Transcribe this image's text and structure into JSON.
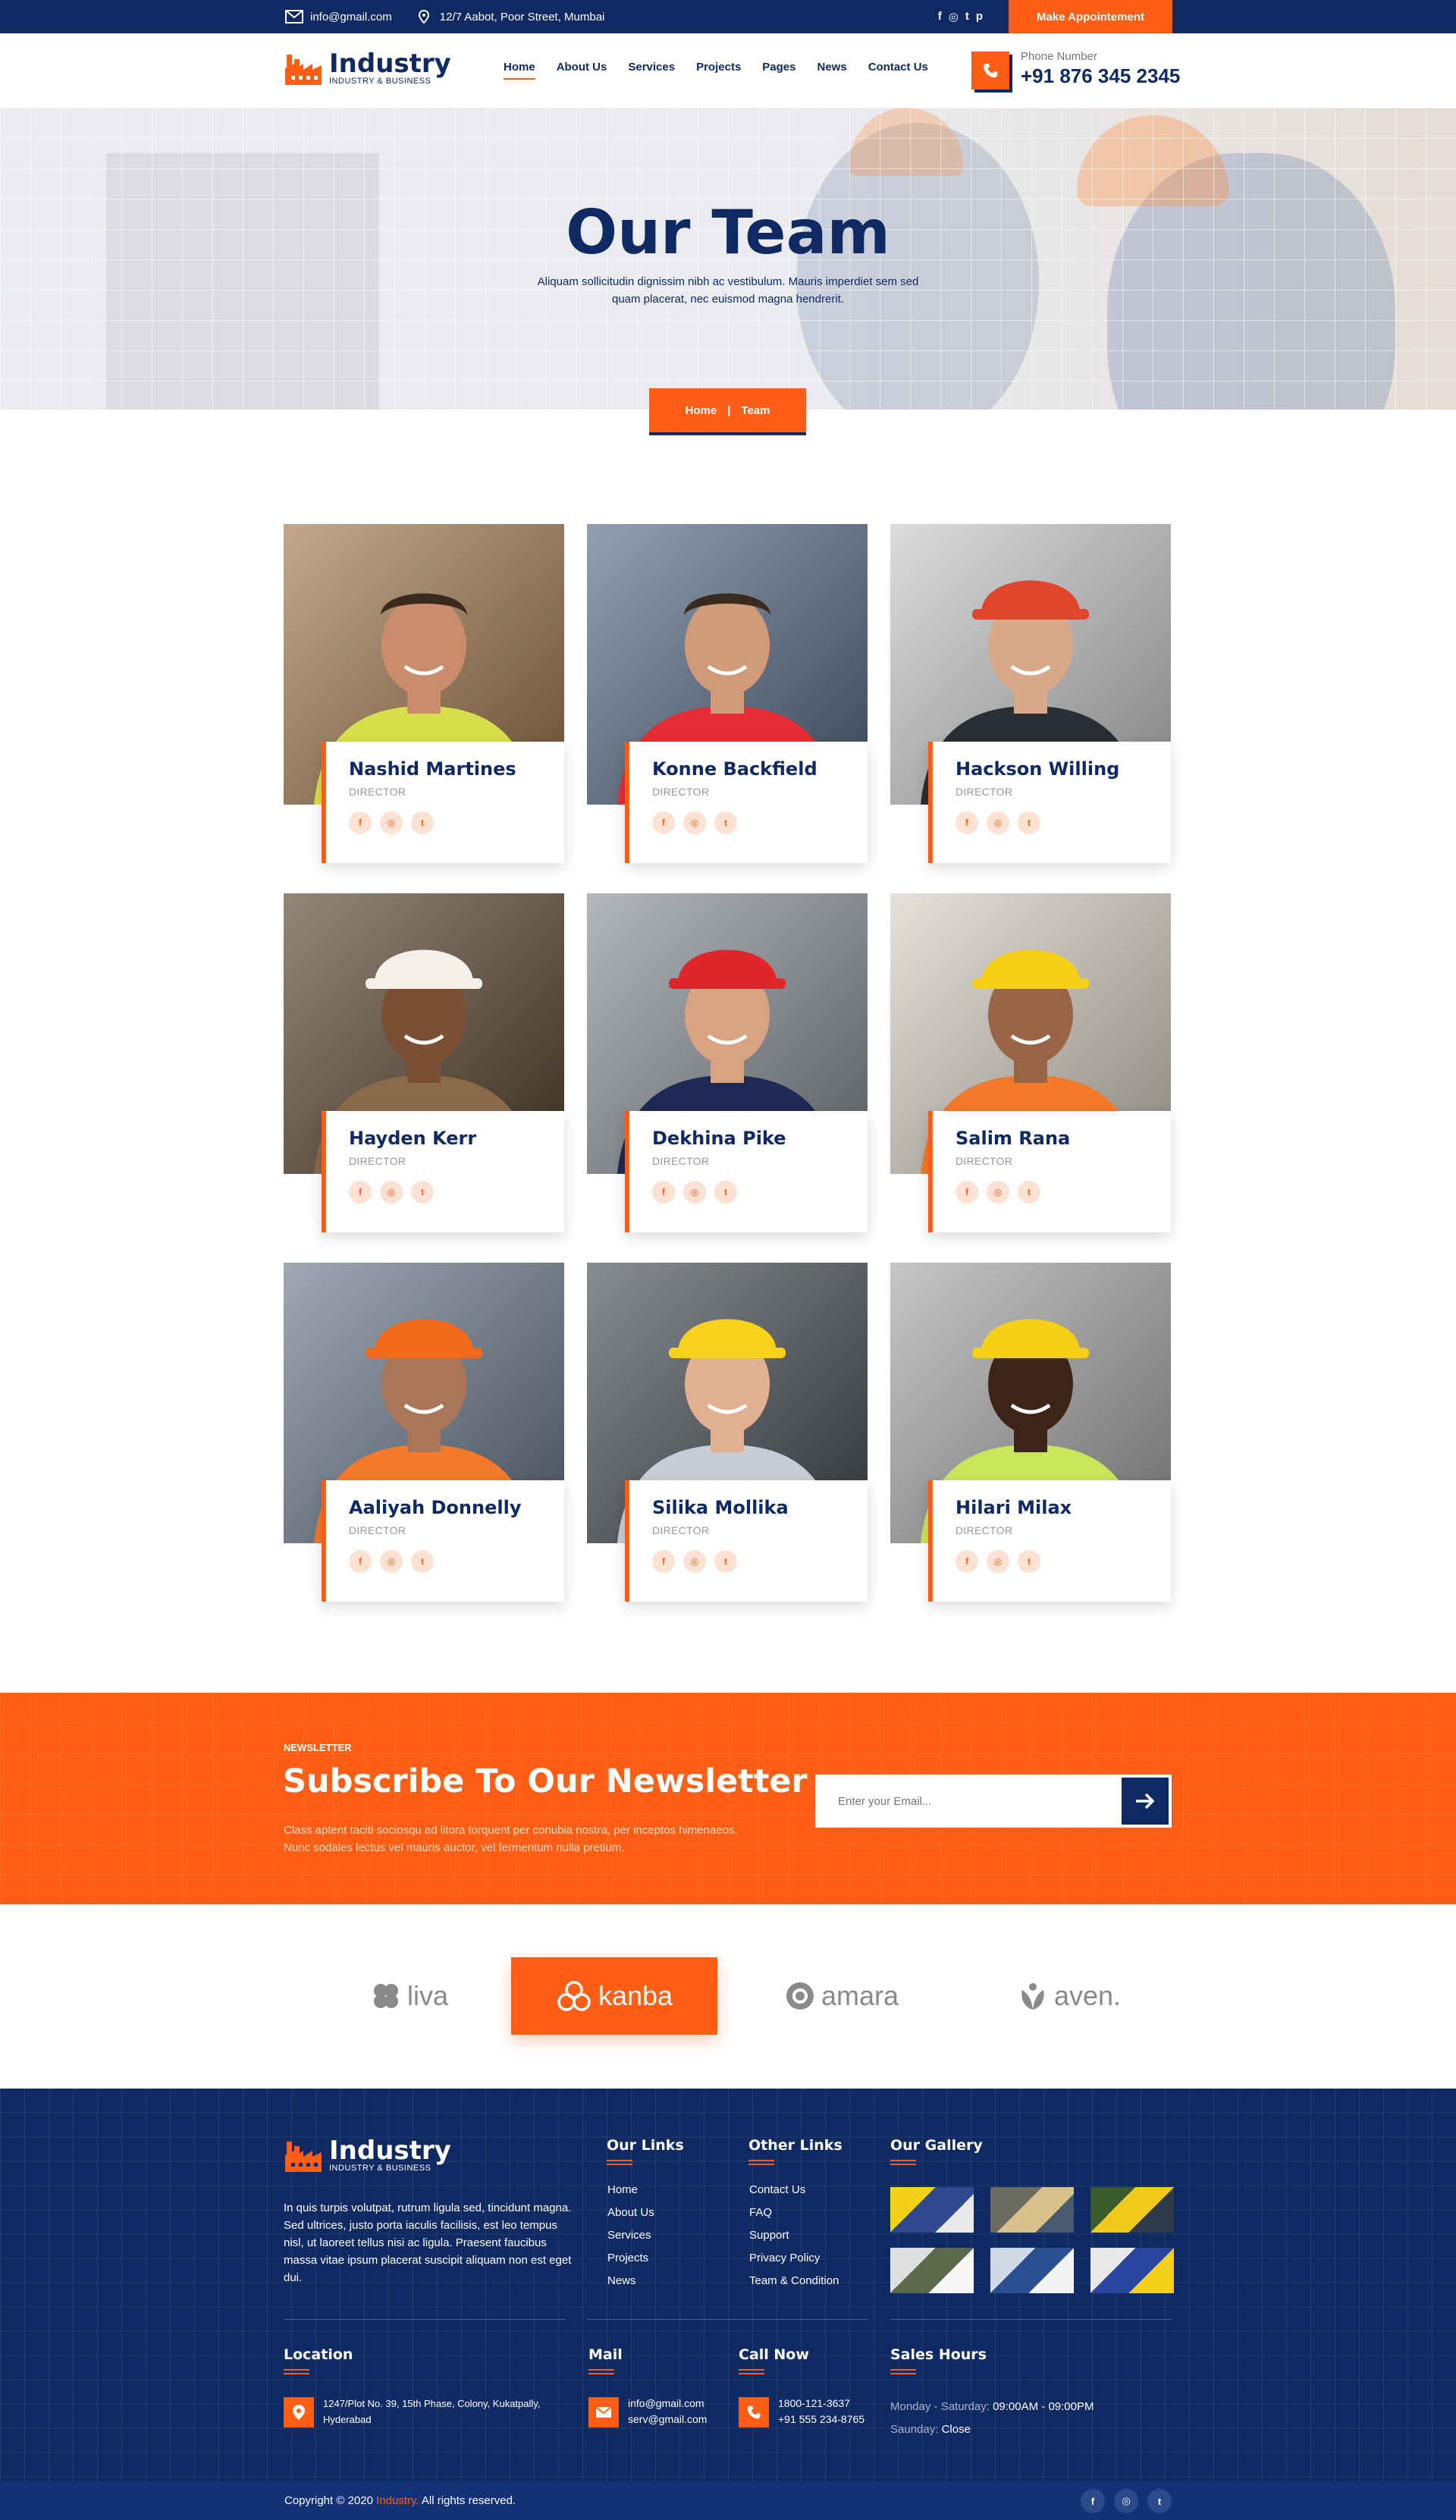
{
  "topbar": {
    "email": "info@gmail.com",
    "address": "12/7 Aabot, Poor Street, Mumbai",
    "social": [
      "f",
      "◎",
      "t",
      "p"
    ],
    "appointment": "Make Appointement"
  },
  "brand": {
    "name": "Industry",
    "tagline": "INDUSTRY & BUSINESS"
  },
  "nav": [
    "Home",
    "About Us",
    "Services",
    "Projects",
    "Pages",
    "News",
    "Contact Us"
  ],
  "phone": {
    "label": "Phone Number",
    "number": "+91 876 345 2345"
  },
  "hero": {
    "title": "Our Team",
    "text": "Aliquam sollicitudin dignissim nibh ac vestibulum. Mauris imperdiet sem sed quam placerat, nec euismod magna hendrerit.",
    "crumb_home": "Home",
    "crumb_sep": "|",
    "crumb_current": "Team"
  },
  "team": [
    {
      "name": "Nashid Martines",
      "role": "DIRECTOR",
      "bg": "#a07a4e",
      "shirt": "#d7e04a",
      "helmet": "",
      "skin": "#c98d6b"
    },
    {
      "name": "Konne Backfield",
      "role": "DIRECTOR",
      "bg": "#586c86",
      "shirt": "#e62c34",
      "helmet": "",
      "skin": "#d19a78"
    },
    {
      "name": "Hackson Willing",
      "role": "DIRECTOR",
      "bg": "#c7c9cc",
      "shirt": "#2a2d33",
      "helmet": "#e0442a",
      "skin": "#d7a98a"
    },
    {
      "name": "Hayden Kerr",
      "role": "DIRECTOR",
      "bg": "#5a4630",
      "shirt": "#8a6a48",
      "helmet": "#f3f1ea",
      "skin": "#7a4f33"
    },
    {
      "name": "Dekhina Pike",
      "role": "DIRECTOR",
      "bg": "#8b8f96",
      "shirt": "#1e2a55",
      "helmet": "#e0262a",
      "skin": "#d8a283"
    },
    {
      "name": "Salim Rana",
      "role": "DIRECTOR",
      "bg": "#d7d1c6",
      "shirt": "#f27a2a",
      "helmet": "#f6cf16",
      "skin": "#9a6446"
    },
    {
      "name": "Aaliyah Donnelly",
      "role": "DIRECTOR",
      "bg": "#6a7a8a",
      "shirt": "#f27a2a",
      "helmet": "#f26a1c",
      "skin": "#a9765a"
    },
    {
      "name": "Silika Mollika",
      "role": "DIRECTOR",
      "bg": "#4a4e56",
      "shirt": "#c9ccd6",
      "helmet": "#f6d21a",
      "skin": "#e0b090"
    },
    {
      "name": "Hilari Milax",
      "role": "DIRECTOR",
      "bg": "#a7a9a6",
      "shirt": "#c9e65a",
      "helmet": "#f6cf16",
      "skin": "#3e2418"
    }
  ],
  "member_social": [
    "f",
    "◎",
    "t"
  ],
  "newsletter": {
    "kicker": "NEWSLETTER",
    "title": "Subscribe To Our Newsletter",
    "text": "Class aptent taciti sociosqu ad litora torquent per conubia nostra, per inceptos himenaeos. Nunc sodales lectus vel mauris auctor, vel fermentum nulla pretium.",
    "placeholder": "Enter your Email..."
  },
  "brands": [
    "liva",
    "kanba",
    "amara",
    "aven."
  ],
  "footer": {
    "about": "In quis turpis volutpat, rutrum ligula sed, tincidunt magna. Sed ultrices, justo porta iaculis facilisis, est leo tempus nisl, ut laoreet tellus nisi ac ligula. Praesent faucibus massa vitae ipsum placerat suscipit aliquam non est eget dui.",
    "our_links_title": "Our Links",
    "our_links": [
      "Home",
      "About Us",
      "Services",
      "Projects",
      "News"
    ],
    "other_links_title": "Other Links",
    "other_links": [
      "Contact Us",
      "FAQ",
      "Support",
      "Privacy Policy",
      "Team & Condition"
    ],
    "gallery_title": "Our Gallery",
    "location_title": "Location",
    "location": "1247/Plot No. 39, 15th Phase, Colony, Kukatpally, Hyderabad",
    "mail_title": "Mail",
    "mail": [
      "info@gmail.com",
      "serv@gmail.com"
    ],
    "call_title": "Call Now",
    "call": [
      "1800-121-3637",
      "+91 555 234-8765"
    ],
    "hours_title": "Sales Hours",
    "hours_weekday_label": "Monday - Saturday:",
    "hours_weekday": "09:00AM - 09:00PM",
    "hours_sunday_label": "Saunday:",
    "hours_sunday": "Close",
    "copyright_pre": "Copyright © 2020",
    "copyright_brand": "Industry.",
    "copyright_post": "All rights reserved.",
    "social": [
      "f",
      "◎",
      "t"
    ]
  },
  "colors": {
    "navy": "#0f2a63",
    "orange": "#ff5e14"
  }
}
